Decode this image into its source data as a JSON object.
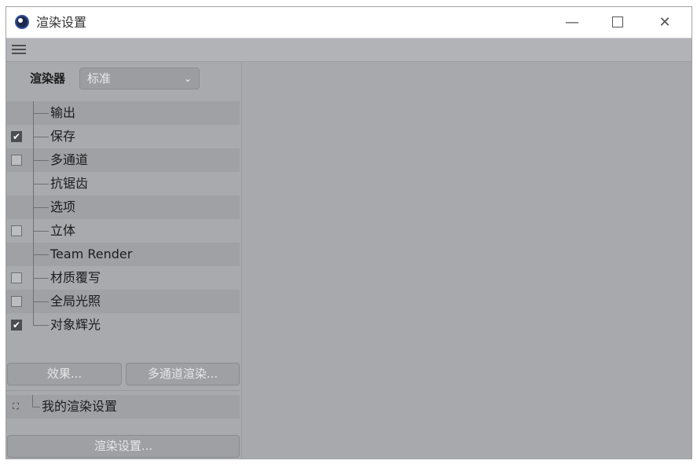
{
  "window": {
    "title": "渲染设置",
    "minimize_glyph": "—",
    "close_glyph": "✕"
  },
  "icons": {
    "app": "cinema4d-logo-icon",
    "menu": "hamburger-menu-icon",
    "dropdown": "chevron-down-icon",
    "check": "checkmark-icon",
    "preset": "render-preset-icon"
  },
  "renderer": {
    "label": "渲染器",
    "selected": "标准",
    "chevron": "⌄"
  },
  "tree": [
    {
      "label": "输出",
      "has_checkbox": false,
      "checked": false
    },
    {
      "label": "保存",
      "has_checkbox": true,
      "checked": true
    },
    {
      "label": "多通道",
      "has_checkbox": true,
      "checked": false
    },
    {
      "label": "抗锯齿",
      "has_checkbox": false,
      "checked": false
    },
    {
      "label": "选项",
      "has_checkbox": false,
      "checked": false
    },
    {
      "label": "立体",
      "has_checkbox": true,
      "checked": false
    },
    {
      "label": "Team Render",
      "has_checkbox": false,
      "checked": false
    },
    {
      "label": "材质覆写",
      "has_checkbox": true,
      "checked": false
    },
    {
      "label": "全局光照",
      "has_checkbox": true,
      "checked": false
    },
    {
      "label": "对象辉光",
      "has_checkbox": true,
      "checked": true
    }
  ],
  "buttons": {
    "effects": "效果...",
    "multipass_render": "多通道渲染...",
    "render_settings": "渲染设置..."
  },
  "preset": {
    "label": "我的渲染设置",
    "icon_glyph": "⛶"
  },
  "check_glyph": "✔"
}
